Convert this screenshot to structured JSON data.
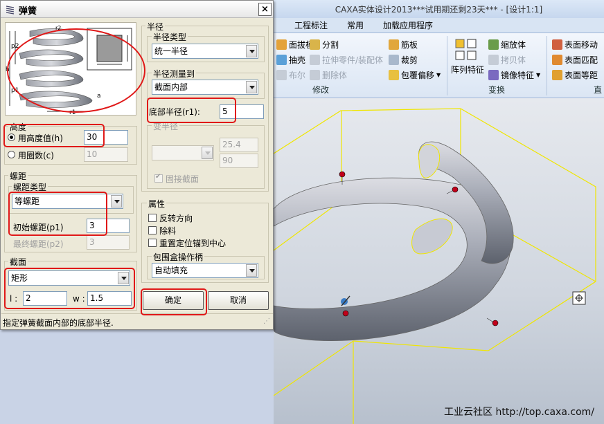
{
  "app": {
    "title": "CAXA实体设计2013***试用期还剩23天*** - [设计1:1]",
    "tabs": [
      "工程标注",
      "常用",
      "加载应用程序"
    ],
    "ribbon": {
      "col1": [
        "面拔模",
        "抽壳",
        "布尔"
      ],
      "col2": [
        "分割",
        "拉伸零件/装配体",
        "删除体"
      ],
      "col3": [
        "筋板",
        "裁剪",
        "包覆偏移"
      ],
      "group_modify": "修改",
      "array_feature": "阵列特征",
      "col5": [
        "缩放体",
        "拷贝体",
        "镜像特征"
      ],
      "group_transform": "变换",
      "col6": [
        "表面移动",
        "表面匹配",
        "表面等距"
      ],
      "group_direct": "直"
    },
    "watermark": "工业云社区 http://top.caxa.com/"
  },
  "dialog": {
    "title": "弹簧",
    "close": "×",
    "height_group": {
      "label": "高度",
      "opt_height": "用高度值(h)",
      "height_value": "30",
      "opt_turns": "用圈数(c)",
      "turns_value": "10"
    },
    "pitch_group": {
      "label": "螺距",
      "type_label": "螺距类型",
      "type_value": "等螺距",
      "initial_label": "初始螺距(p1)",
      "initial_value": "3",
      "final_label": "最终螺距(p2)",
      "final_value": "3"
    },
    "section_group": {
      "label": "截面",
      "shape_value": "矩形",
      "l_label": "l :",
      "l_value": "2",
      "w_label": "w :",
      "w_value": "1.5"
    },
    "radius_group": {
      "label": "半径",
      "type_label": "半径类型",
      "type_value": "统一半径",
      "measure_label": "半径测量到",
      "measure_value": "截面内部",
      "bottom_label": "底部半径(r1):",
      "bottom_value": "5",
      "var_label": "变半径",
      "var_value1": "25.4",
      "var_value2": "90",
      "fixed_section": "固接截面"
    },
    "props_group": {
      "label": "属性",
      "reverse": "反转方向",
      "remove": "除料",
      "reset_anchor": "重置定位锚到中心",
      "bbox_label": "包围盒操作柄",
      "bbox_value": "自动填充"
    },
    "ok": "确定",
    "cancel": "取消",
    "status": "指定弹簧截面内部的底部半径.",
    "preview_labels": {
      "p2": "p2",
      "p1": "p1",
      "r1": "r1",
      "h": "h",
      "a": "a",
      "r2": "r2"
    }
  },
  "colors": {
    "annotation_red": "#e01818",
    "wireframe_yellow": "#f0e600",
    "handle_red": "#c0001a"
  }
}
